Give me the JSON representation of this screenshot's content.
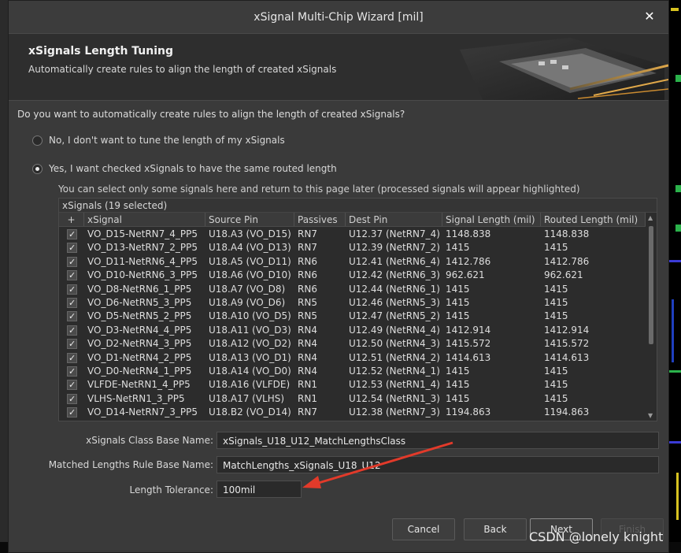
{
  "window": {
    "title": "xSignal Multi-Chip Wizard [mil]",
    "close_icon": "close-icon"
  },
  "header": {
    "title": "xSignals Length Tuning",
    "subtitle": "Automatically create rules to align the length of created xSignals"
  },
  "question": "Do you want to automatically create rules to align the length of created xSignals?",
  "options": [
    {
      "label": "No, I don't want to tune the length of my xSignals",
      "selected": false
    },
    {
      "label": "Yes, I want checked xSignals to have the same routed length",
      "selected": true
    }
  ],
  "hint": "You can select only some signals here and return to this page later (processed signals will appear highlighted)",
  "grid": {
    "title": "xSignals (19 selected)",
    "columns": [
      "+",
      "xSignal",
      "Source Pin",
      "Passives",
      "Dest Pin",
      "Signal Length (mil)",
      "Routed Length (mil)"
    ],
    "rows": [
      [
        "VO_D15-NetRN7_4_PP5",
        "U18.A3 (VO_D15)",
        "RN7",
        "U12.37 (NetRN7_4)",
        "1148.838",
        "1148.838"
      ],
      [
        "VO_D13-NetRN7_2_PP5",
        "U18.A4 (VO_D13)",
        "RN7",
        "U12.39 (NetRN7_2)",
        "1415",
        "1415"
      ],
      [
        "VO_D11-NetRN6_4_PP5",
        "U18.A5 (VO_D11)",
        "RN6",
        "U12.41 (NetRN6_4)",
        "1412.786",
        "1412.786"
      ],
      [
        "VO_D10-NetRN6_3_PP5",
        "U18.A6 (VO_D10)",
        "RN6",
        "U12.42 (NetRN6_3)",
        "962.621",
        "962.621"
      ],
      [
        "VO_D8-NetRN6_1_PP5",
        "U18.A7 (VO_D8)",
        "RN6",
        "U12.44 (NetRN6_1)",
        "1415",
        "1415"
      ],
      [
        "VO_D6-NetRN5_3_PP5",
        "U18.A9 (VO_D6)",
        "RN5",
        "U12.46 (NetRN5_3)",
        "1415",
        "1415"
      ],
      [
        "VO_D5-NetRN5_2_PP5",
        "U18.A10 (VO_D5)",
        "RN5",
        "U12.47 (NetRN5_2)",
        "1415",
        "1415"
      ],
      [
        "VO_D3-NetRN4_4_PP5",
        "U18.A11 (VO_D3)",
        "RN4",
        "U12.49 (NetRN4_4)",
        "1412.914",
        "1412.914"
      ],
      [
        "VO_D2-NetRN4_3_PP5",
        "U18.A12 (VO_D2)",
        "RN4",
        "U12.50 (NetRN4_3)",
        "1415.572",
        "1415.572"
      ],
      [
        "VO_D1-NetRN4_2_PP5",
        "U18.A13 (VO_D1)",
        "RN4",
        "U12.51 (NetRN4_2)",
        "1414.613",
        "1414.613"
      ],
      [
        "VO_D0-NetRN4_1_PP5",
        "U18.A14 (VO_D0)",
        "RN4",
        "U12.52 (NetRN4_1)",
        "1415",
        "1415"
      ],
      [
        "VLFDE-NetRN1_4_PP5",
        "U18.A16 (VLFDE)",
        "RN1",
        "U12.53 (NetRN1_4)",
        "1415",
        "1415"
      ],
      [
        "VLHS-NetRN1_3_PP5",
        "U18.A17 (VLHS)",
        "RN1",
        "U12.54 (NetRN1_3)",
        "1415",
        "1415"
      ],
      [
        "VO_D14-NetRN7_3_PP5",
        "U18.B2 (VO_D14)",
        "RN7",
        "U12.38 (NetRN7_3)",
        "1194.863",
        "1194.863"
      ]
    ]
  },
  "fields": {
    "class_base_label": "xSignals Class Base Name:",
    "class_base_value": "xSignals_U18_U12_MatchLengthsClass",
    "rule_base_label": "Matched Lengths Rule Base Name:",
    "rule_base_value": "MatchLengths_xSignals_U18_U12",
    "tolerance_label": "Length Tolerance:",
    "tolerance_value": "100mil"
  },
  "buttons": {
    "cancel": "Cancel",
    "back": "Back",
    "next": "Next",
    "finish": "Finish"
  },
  "watermark": "CSDN @lonely knight",
  "colors": {
    "annotation_arrow": "#e23a2a",
    "dialog_bg": "#3a3a3a"
  }
}
